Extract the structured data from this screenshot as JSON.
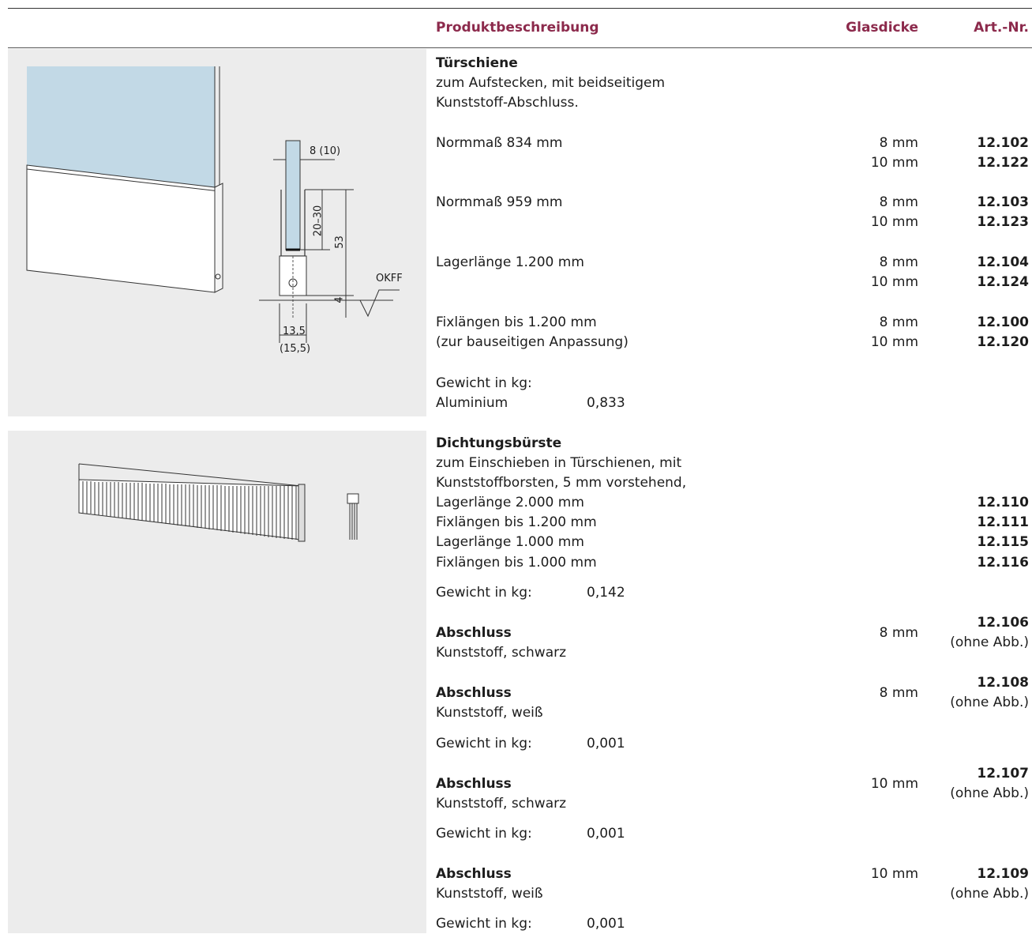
{
  "header": {
    "produktbeschreibung": "Produktbeschreibung",
    "glasdicke": "Glasdicke",
    "artnr": "Art.-Nr.",
    "accent_color": "#8c2a4c"
  },
  "turschiene": {
    "title": "Türschiene",
    "desc1": "zum Aufstecken, mit beidseitigem",
    "desc2": "Kunststoff-Abschluss.",
    "rows": [
      {
        "label": "Normmaß 834 mm",
        "glass": [
          "8 mm",
          "10 mm"
        ],
        "art": [
          "12.102",
          "12.122"
        ]
      },
      {
        "label": "Normmaß 959 mm",
        "glass": [
          "8 mm",
          "10 mm"
        ],
        "art": [
          "12.103",
          "12.123"
        ]
      },
      {
        "label": "Lagerlänge 1.200 mm",
        "glass": [
          "8 mm",
          "10 mm"
        ],
        "art": [
          "12.104",
          "12.124"
        ]
      },
      {
        "label": "Fixlängen bis 1.200 mm",
        "label2": "(zur bauseitigen Anpassung)",
        "glass": [
          "8 mm",
          "10 mm"
        ],
        "art": [
          "12.100",
          "12.120"
        ]
      }
    ],
    "weight_label": "Gewicht in kg:",
    "material": "Aluminium",
    "weight": "0,833",
    "drawing": {
      "dim_width": "8 (10)",
      "dim_insert": "20–30",
      "dim_height": "53",
      "dim_bottom": "4",
      "okff": "OKFF",
      "dim_base": "13,5",
      "dim_base_alt": "(15,5)"
    }
  },
  "dichtungsburste": {
    "title": "Dichtungsbürste",
    "desc1": "zum Einschieben in Türschienen, mit",
    "desc2": "Kunststoffborsten, 5 mm vorstehend,",
    "rows": [
      {
        "label": "Lagerlänge 2.000 mm",
        "art": "12.110"
      },
      {
        "label": "Fixlängen bis 1.200 mm",
        "art": "12.111"
      },
      {
        "label": "Lagerlänge 1.000 mm",
        "art": "12.115"
      },
      {
        "label": "Fixlängen bis 1.000 mm",
        "art": "12.116"
      }
    ],
    "weight_label": "Gewicht in kg:",
    "weight": "0,142"
  },
  "abschluss": [
    {
      "title": "Abschluss",
      "desc": "Kunststoff, schwarz",
      "glass": "8 mm",
      "art": "12.106",
      "note": "(ohne Abb.)"
    },
    {
      "title": "Abschluss",
      "desc": "Kunststoff, weiß",
      "glass": "8 mm",
      "art": "12.108",
      "note": "(ohne Abb.)",
      "weight_label": "Gewicht in kg:",
      "weight": "0,001"
    },
    {
      "title": "Abschluss",
      "desc": "Kunststoff, schwarz",
      "glass": "10 mm",
      "art": "12.107",
      "note": "(ohne Abb.)",
      "weight_label": "Gewicht in kg:",
      "weight": "0,001"
    },
    {
      "title": "Abschluss",
      "desc": "Kunststoff, weiß",
      "glass": "10 mm",
      "art": "12.109",
      "note": "(ohne Abb.)",
      "weight_label": "Gewicht in kg:",
      "weight": "0,001"
    }
  ]
}
